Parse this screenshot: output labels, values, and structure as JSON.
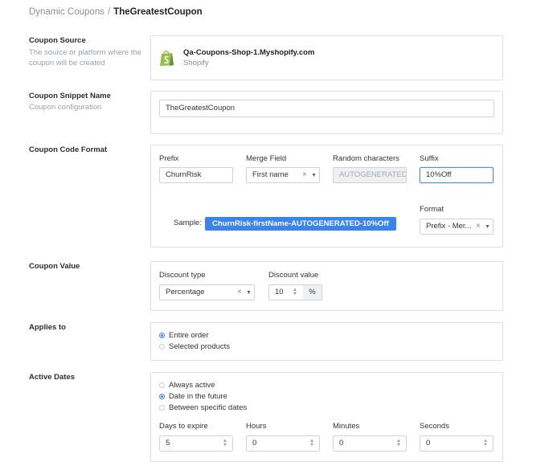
{
  "breadcrumb": {
    "parent": "Dynamic Coupons",
    "separator": "/",
    "current": "TheGreatestCoupon"
  },
  "coupon_source": {
    "title": "Coupon Source",
    "description": "The source or platform where the coupon will be created",
    "shop_name": "Qa-Coupons-Shop-1.Myshopify.com",
    "platform": "Shopify",
    "icon": "shopify-bag-icon"
  },
  "snippet_name": {
    "title": "Coupon Snippet Name",
    "description": "Coupon configuration",
    "value": "TheGreatestCoupon"
  },
  "code_format": {
    "title": "Coupon Code Format",
    "prefix_label": "Prefix",
    "prefix_value": "ChurnRisk",
    "merge_label": "Merge Field",
    "merge_value": "First name",
    "random_label": "Random characters",
    "random_value": "AUTOGENERATED",
    "suffix_label": "Suffix",
    "suffix_value": "10%Off",
    "sample_label": "Sample:",
    "sample_value": "ChurnRisk-firstName-AUTOGENERATED-10%Off",
    "format_label": "Format",
    "format_value": "Prefix - Mer..."
  },
  "coupon_value": {
    "title": "Coupon Value",
    "type_label": "Discount type",
    "type_value": "Percentage",
    "value_label": "Discount value",
    "value": "10",
    "unit": "%"
  },
  "applies_to": {
    "title": "Applies to",
    "options": [
      "Entire order",
      "Selected products"
    ],
    "selected_index": 0
  },
  "active_dates": {
    "title": "Active Dates",
    "options": [
      "Always active",
      "Date in the future",
      "Between specific dates"
    ],
    "selected_index": 1,
    "days_label": "Days to expire",
    "days_value": "5",
    "hours_label": "Hours",
    "hours_value": "0",
    "minutes_label": "Minutes",
    "minutes_value": "0",
    "seconds_label": "Seconds",
    "seconds_value": "0"
  },
  "colors": {
    "accent": "#3b84ee",
    "shopify_green": "#95bf47",
    "border": "#dcdfe3"
  }
}
